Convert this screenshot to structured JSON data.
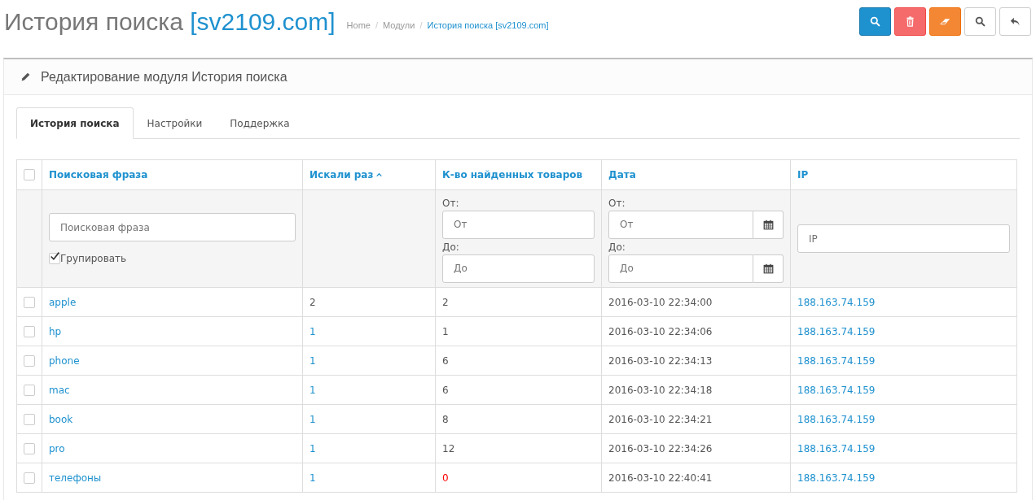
{
  "header": {
    "title": "История поиска",
    "title_site": "[sv2109.com]",
    "breadcrumbs": [
      {
        "label": "Home"
      },
      {
        "separator": "/",
        "label": "Модули"
      },
      {
        "separator": "/",
        "label": "История поиска [sv2109.com]"
      }
    ]
  },
  "toolbar": [
    {
      "kind": "search"
    },
    {
      "kind": "delete"
    },
    {
      "kind": "eraser"
    },
    {
      "kind": "search"
    },
    {
      "kind": "back"
    }
  ],
  "panel": {
    "title": "Редактирование модуля История поиска"
  },
  "tabs": [
    {
      "label": "История поиска",
      "selected": true
    },
    {
      "label": "Настройки",
      "selected": false
    },
    {
      "label": "Поддержка",
      "selected": false
    }
  ],
  "table": {
    "select_all_checked": false,
    "columns": [
      {
        "label": "Поисковая фраза",
        "sorted": false
      },
      {
        "label": "Искали раз",
        "sorted": true
      },
      {
        "label": "К-во найденных товаров",
        "sorted": false
      },
      {
        "label": "Дата",
        "sorted": false
      },
      {
        "label": "IP",
        "sorted": false
      }
    ],
    "filters": {
      "phrase": {
        "placeholder": "Поисковая фраза"
      },
      "group": {
        "label": "Групировать",
        "checked": true
      },
      "found_from": {
        "label": "От:",
        "placeholder": "От"
      },
      "found_to": {
        "label": "До:",
        "placeholder": "До"
      },
      "date_from": {
        "label": "От:",
        "placeholder": "От"
      },
      "date_to": {
        "label": "До:",
        "placeholder": "До"
      },
      "ip": {
        "placeholder": "IP"
      }
    },
    "rows": [
      {
        "checked": false,
        "phrase": "apple",
        "searched": "2",
        "searched_link": false,
        "found": "2",
        "found_warning": false,
        "date": "2016-03-10 22:34:00",
        "ip": "188.163.74.159"
      },
      {
        "checked": false,
        "phrase": "hp",
        "searched": "1",
        "searched_link": true,
        "found": "1",
        "found_warning": false,
        "date": "2016-03-10 22:34:06",
        "ip": "188.163.74.159"
      },
      {
        "checked": false,
        "phrase": "phone",
        "searched": "1",
        "searched_link": true,
        "found": "6",
        "found_warning": false,
        "date": "2016-03-10 22:34:13",
        "ip": "188.163.74.159"
      },
      {
        "checked": false,
        "phrase": "mac",
        "searched": "1",
        "searched_link": true,
        "found": "6",
        "found_warning": false,
        "date": "2016-03-10 22:34:18",
        "ip": "188.163.74.159"
      },
      {
        "checked": false,
        "phrase": "book",
        "searched": "1",
        "searched_link": true,
        "found": "8",
        "found_warning": false,
        "date": "2016-03-10 22:34:21",
        "ip": "188.163.74.159"
      },
      {
        "checked": false,
        "phrase": "pro",
        "searched": "1",
        "searched_link": true,
        "found": "12",
        "found_warning": false,
        "date": "2016-03-10 22:34:26",
        "ip": "188.163.74.159"
      },
      {
        "checked": false,
        "phrase": "телефоны",
        "searched": "1",
        "searched_link": true,
        "found": "0",
        "found_warning": true,
        "date": "2016-03-10 22:40:41",
        "ip": "188.163.74.159"
      }
    ]
  }
}
